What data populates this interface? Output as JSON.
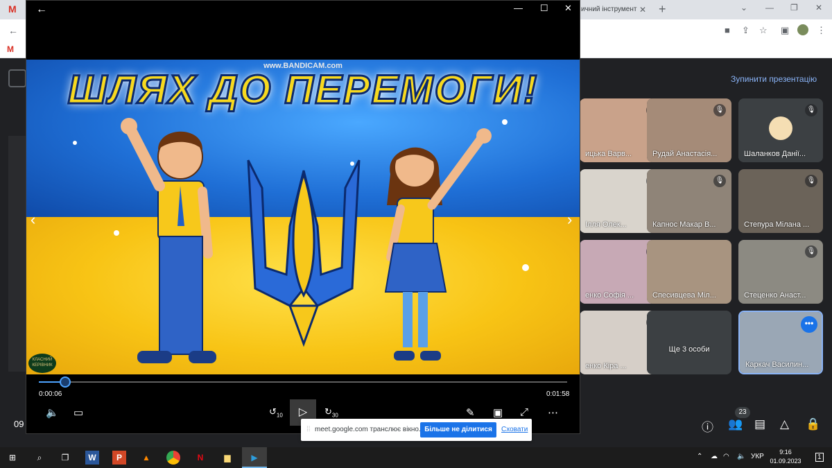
{
  "browser": {
    "tab_title": "ичний інструмент",
    "tab_close": "✕",
    "new_tab": "+",
    "gmail_label": "M",
    "bookmark_label": "M"
  },
  "meet": {
    "stop_presenting": "Зупинити презентацію",
    "time": "09",
    "participants_count": "23",
    "tiles": [
      {
        "name": "ицька Варв...",
        "muted": true,
        "color": "#c9a28a"
      },
      {
        "name": "Рудай Анастасія...",
        "muted": true,
        "color": "#a58b78"
      },
      {
        "name": "Шаланков Данії...",
        "muted": true,
        "color": "#3c4043"
      },
      {
        "name": "Ілля Олек...",
        "muted": true,
        "color": "#d9d4cc"
      },
      {
        "name": "Капнос Макар В...",
        "muted": true,
        "color": "#8f8478"
      },
      {
        "name": "Степура Мілана ...",
        "muted": true,
        "color": "#6b6359"
      },
      {
        "name": "енко Софія ...",
        "muted": true,
        "color": "#c7a9b5"
      },
      {
        "name": "Спесивцева Міл...",
        "muted": false,
        "color": "#a89480"
      },
      {
        "name": "Стеценко Анаст...",
        "muted": true,
        "color": "#8c8a82"
      },
      {
        "name": "енко Кіра ...",
        "muted": true,
        "color": "#d6cfc8"
      },
      {
        "name": "Ще 3 особи",
        "muted": false,
        "color": "#3c4043"
      },
      {
        "name": "Каркач Василин...",
        "muted": false,
        "color": "#9aa7b5"
      }
    ],
    "more_dots": "•••"
  },
  "player": {
    "title_art": "ШЛЯХ ДО ПЕРЕМОГИ!",
    "watermark": "www.BANDICAM.com",
    "logo_text": "КЛАСНИЙ КЕРІВНИК",
    "current_time": "0:00:06",
    "total_time": "0:01:58",
    "progress_fraction": 0.05,
    "skip_back": "10",
    "skip_fwd": "30"
  },
  "sharebar": {
    "message": "meet.google.com транслює вікно.",
    "stop_button": "Більше не ділитися",
    "hide_link": "Сховати"
  },
  "taskbar": {
    "lang": "УКР",
    "time": "9:16",
    "date": "01.09.2023",
    "notif_count": "1"
  }
}
